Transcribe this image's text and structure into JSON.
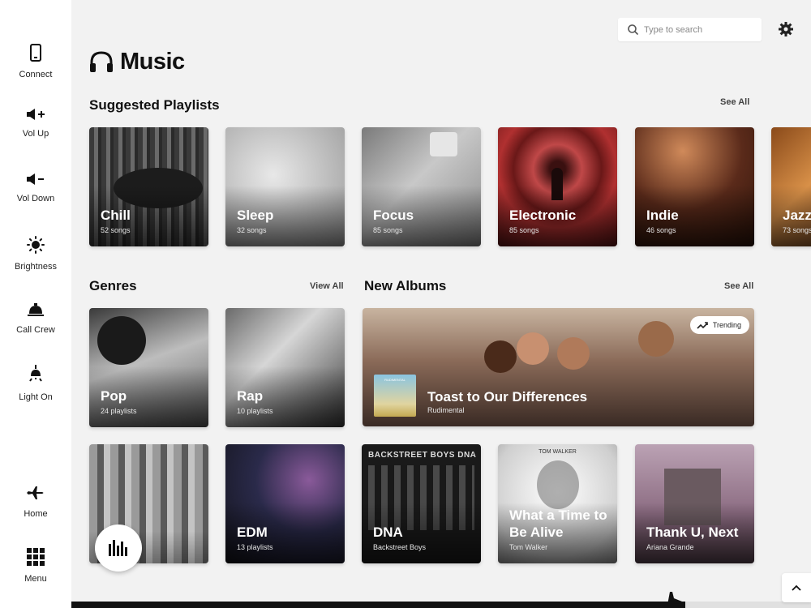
{
  "sidebar": {
    "items": [
      {
        "label": "Connect",
        "icon": "phone-icon"
      },
      {
        "label": "Vol Up",
        "icon": "volume-up-icon"
      },
      {
        "label": "Vol Down",
        "icon": "volume-down-icon"
      },
      {
        "label": "Brightness",
        "icon": "brightness-icon"
      },
      {
        "label": "Call Crew",
        "icon": "bell-icon"
      },
      {
        "label": "Light On",
        "icon": "light-icon"
      },
      {
        "label": "Home",
        "icon": "airplane-icon"
      },
      {
        "label": "Menu",
        "icon": "grid-icon"
      }
    ]
  },
  "header": {
    "title": "Music",
    "title_icon": "headphones-icon",
    "search_placeholder": "Type to search",
    "settings_icon": "gear-icon"
  },
  "suggested": {
    "title": "Suggested Playlists",
    "link": "See All",
    "items": [
      {
        "title": "Chill",
        "sub": "52 songs"
      },
      {
        "title": "Sleep",
        "sub": "32 songs"
      },
      {
        "title": "Focus",
        "sub": "85 songs"
      },
      {
        "title": "Electronic",
        "sub": "85 songs"
      },
      {
        "title": "Indie",
        "sub": "46 songs"
      },
      {
        "title": "Jazz",
        "sub": "73 songs"
      }
    ]
  },
  "genres": {
    "title": "Genres",
    "link": "View All",
    "items": [
      {
        "title": "Pop",
        "sub": "24 playlists"
      },
      {
        "title": "Rap",
        "sub": "10 playlists"
      },
      {
        "title": "",
        "sub": ""
      },
      {
        "title": "EDM",
        "sub": "13 playlists"
      }
    ]
  },
  "albums": {
    "title": "New Albums",
    "link": "See All",
    "featured": {
      "title": "Toast to Our Differences",
      "artist": "Rudimental",
      "badge": "Trending",
      "thumb_text": "RUDIMENTAL"
    },
    "items": [
      {
        "title": "DNA",
        "artist": "Backstreet Boys",
        "cover_text": "BACKSTREET BOYS DNA"
      },
      {
        "title": "What a Time to Be Alive",
        "artist": "Tom Walker",
        "cover_text": "TOM WALKER"
      },
      {
        "title": "Thank U, Next",
        "artist": "Ariana Grande"
      }
    ]
  },
  "player": {
    "fab_icon": "equalizer-icon",
    "flight_progress": 0.83,
    "plane_icon": "airplane-icon",
    "scroll_top_icon": "chevron-up-icon"
  },
  "colors": {
    "background": "#f2f2f2",
    "sidebar": "#ffffff",
    "text": "#111111"
  }
}
